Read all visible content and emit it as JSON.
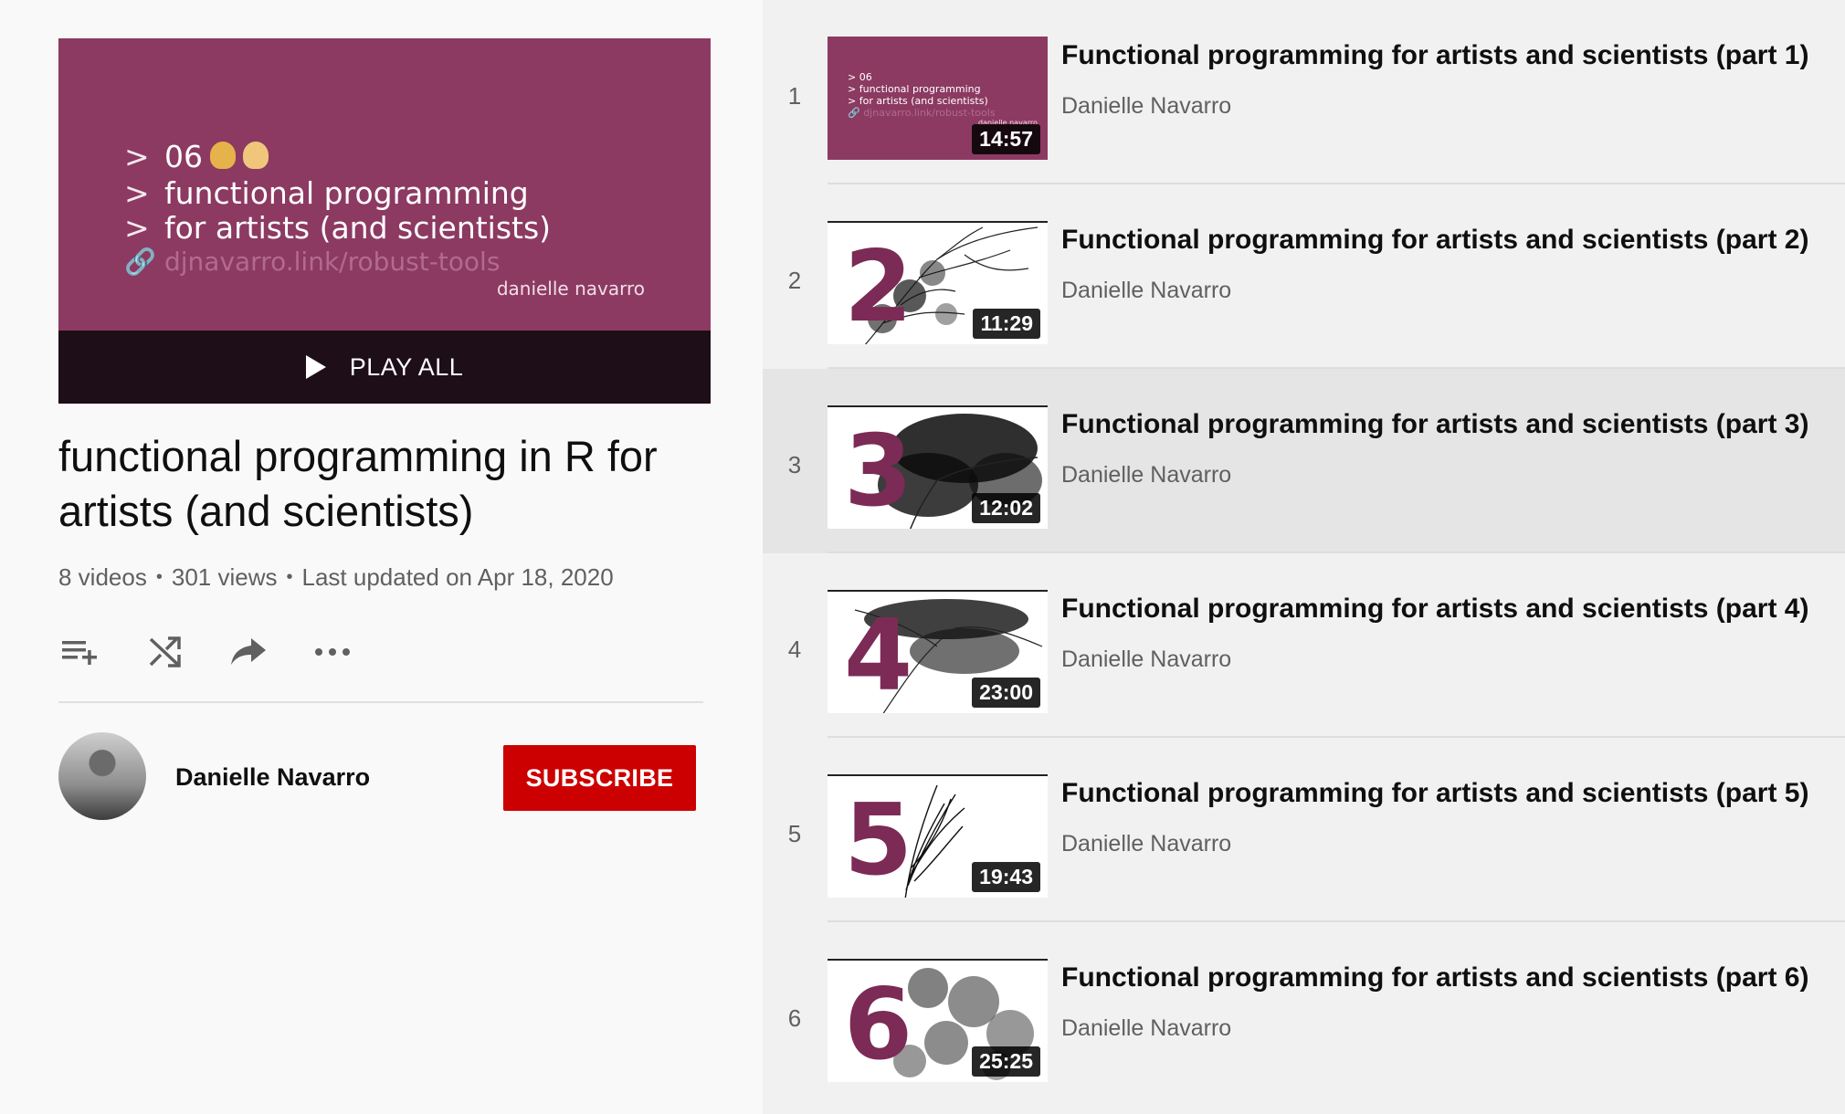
{
  "hero": {
    "lines": [
      "06",
      "functional programming",
      "for artists (and scientists)",
      "djnavarro.link/robust-tools"
    ],
    "author": "danielle navarro",
    "play_all_label": "PLAY ALL"
  },
  "playlist": {
    "title": "functional programming in R for artists (and scientists)",
    "video_count": "8 videos",
    "views": "301 views",
    "last_updated": "Last updated on Apr 18, 2020"
  },
  "actions": {
    "icons": [
      "add-to-queue-icon",
      "shuffle-icon",
      "share-icon",
      "more-icon"
    ]
  },
  "channel": {
    "name": "Danielle Navarro",
    "subscribe_label": "SUBSCRIBE"
  },
  "videos": [
    {
      "index": "1",
      "title": "Functional programming for artists and scientists (part 1)",
      "author": "Danielle Navarro",
      "duration": "14:57",
      "thumb_number": "",
      "thumb_lines": [
        "06",
        "functional programming",
        "for artists (and scientists)",
        "djnavarro.link/robust-tools"
      ],
      "thumb_author": "danielle navarro"
    },
    {
      "index": "2",
      "title": "Functional programming for artists and scientists (part 2)",
      "author": "Danielle Navarro",
      "duration": "11:29",
      "thumb_number": "2"
    },
    {
      "index": "3",
      "title": "Functional programming for artists and scientists (part 3)",
      "author": "Danielle Navarro",
      "duration": "12:02",
      "thumb_number": "3"
    },
    {
      "index": "4",
      "title": "Functional programming for artists and scientists (part 4)",
      "author": "Danielle Navarro",
      "duration": "23:00",
      "thumb_number": "4"
    },
    {
      "index": "5",
      "title": "Functional programming for artists and scientists (part 5)",
      "author": "Danielle Navarro",
      "duration": "19:43",
      "thumb_number": "5"
    },
    {
      "index": "6",
      "title": "Functional programming for artists and scientists (part 6)",
      "author": "Danielle Navarro",
      "duration": "25:25",
      "thumb_number": "6"
    }
  ],
  "colors": {
    "accent_purple": "#8c3a62",
    "subscribe_red": "#cc0000",
    "active_row": "#e5e5e5"
  }
}
